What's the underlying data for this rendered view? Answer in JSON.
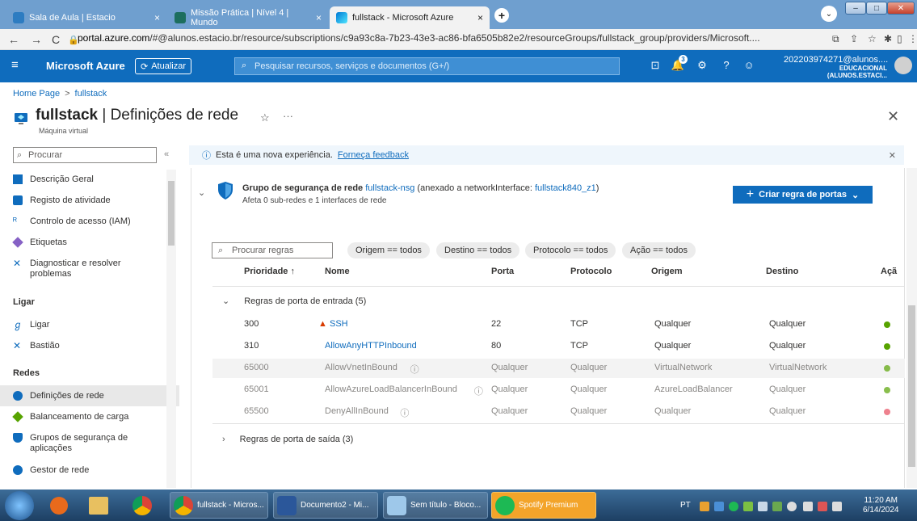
{
  "browser": {
    "tabs": [
      {
        "label": "Sala de Aula | Estacio",
        "close": "×"
      },
      {
        "label": "Missão Prática | Nível 4 | Mundo",
        "close": "×"
      },
      {
        "label": "fullstack - Microsoft Azure",
        "close": "×"
      }
    ],
    "new_tab": "+",
    "url_host": "portal.azure.com",
    "url_rest": "/#@alunos.estacio.br/resource/subscriptions/c9a93c8a-7b23-43e3-ac86-bfa6505b82e2/resourceGroups/fullstack_group/providers/Microsoft...."
  },
  "azure": {
    "brand": "Microsoft Azure",
    "refresh_label": "Atualizar",
    "search_placeholder": "Pesquisar recursos, serviços e documentos (G+/)",
    "notification_count": "3",
    "account_name": "202203974271@alunos....",
    "account_tenant": "EDUCACIONAL (ALUNOS.ESTACI..."
  },
  "page": {
    "breadcrumb_home": "Home Page",
    "breadcrumb_sep": ">",
    "breadcrumb_current": "fullstack",
    "title_resource": "fullstack",
    "title_section": " | Definições de rede",
    "subtitle": "Máquina virtual"
  },
  "sidebar": {
    "search_placeholder": "Procurar",
    "items_top": [
      "Descrição Geral",
      "Registo de atividade",
      "Controlo de acesso (IAM)",
      "Etiquetas",
      "Diagnosticar e resolver problemas"
    ],
    "section_ligar": "Ligar",
    "items_ligar": [
      "Ligar",
      "Bastião"
    ],
    "section_redes": "Redes",
    "items_redes": [
      "Definições de rede",
      "Balanceamento de carga",
      "Grupos de segurança de aplicações",
      "Gestor de rede"
    ]
  },
  "banner": {
    "text": "Esta é uma nova experiência.",
    "link": "Forneça feedback"
  },
  "nsg": {
    "prefix": "Grupo de segurança de rede",
    "name": "fullstack-nsg",
    "attached_prefix": "(anexado a networkInterface:",
    "nic": "fullstack840_z1",
    "attached_suffix": ")",
    "affects": "Afeta 0 sub-redes e 1 interfaces de rede",
    "create_button": "Criar regra de portas"
  },
  "filters": {
    "search_placeholder": "Procurar regras",
    "pills": [
      "Origem == todos",
      "Destino == todos",
      "Protocolo == todos",
      "Ação == todos"
    ]
  },
  "table": {
    "headers": [
      "Prioridade ↑",
      "Nome",
      "Porta",
      "Protocolo",
      "Origem",
      "Destino",
      "Açã"
    ],
    "inbound_group": "Regras de porta de entrada (5)",
    "outbound_group": "Regras de porta de saída (3)",
    "rows": [
      {
        "priority": "300",
        "name": "SSH",
        "port": "22",
        "protocol": "TCP",
        "source": "Qualquer",
        "dest": "Qualquer",
        "action": "allow",
        "warn": true,
        "link": true,
        "default": false
      },
      {
        "priority": "310",
        "name": "AllowAnyHTTPInbound",
        "port": "80",
        "protocol": "TCP",
        "source": "Qualquer",
        "dest": "Qualquer",
        "action": "allow",
        "warn": false,
        "link": true,
        "default": false
      },
      {
        "priority": "65000",
        "name": "AllowVnetInBound",
        "port": "Qualquer",
        "protocol": "Qualquer",
        "source": "VirtualNetwork",
        "dest": "VirtualNetwork",
        "action": "allow",
        "warn": false,
        "link": false,
        "default": true
      },
      {
        "priority": "65001",
        "name": "AllowAzureLoadBalancerInBound",
        "port": "Qualquer",
        "protocol": "Qualquer",
        "source": "AzureLoadBalancer",
        "dest": "Qualquer",
        "action": "allow",
        "warn": false,
        "link": false,
        "default": true
      },
      {
        "priority": "65500",
        "name": "DenyAllInBound",
        "port": "Qualquer",
        "protocol": "Qualquer",
        "source": "Qualquer",
        "dest": "Qualquer",
        "action": "deny",
        "warn": false,
        "link": false,
        "default": true
      }
    ]
  },
  "taskbar": {
    "buttons": [
      "fullstack - Micros...",
      "Documento2 - Mi...",
      "Sem título - Bloco...",
      "Spotify Premium"
    ],
    "lang": "PT",
    "time": "11:20 AM",
    "date": "6/14/2024"
  },
  "colors": {
    "azure_blue": "#0f6cbd",
    "allow": "#57a300",
    "deny": "#e74c5e",
    "warn": "#d83b01"
  }
}
